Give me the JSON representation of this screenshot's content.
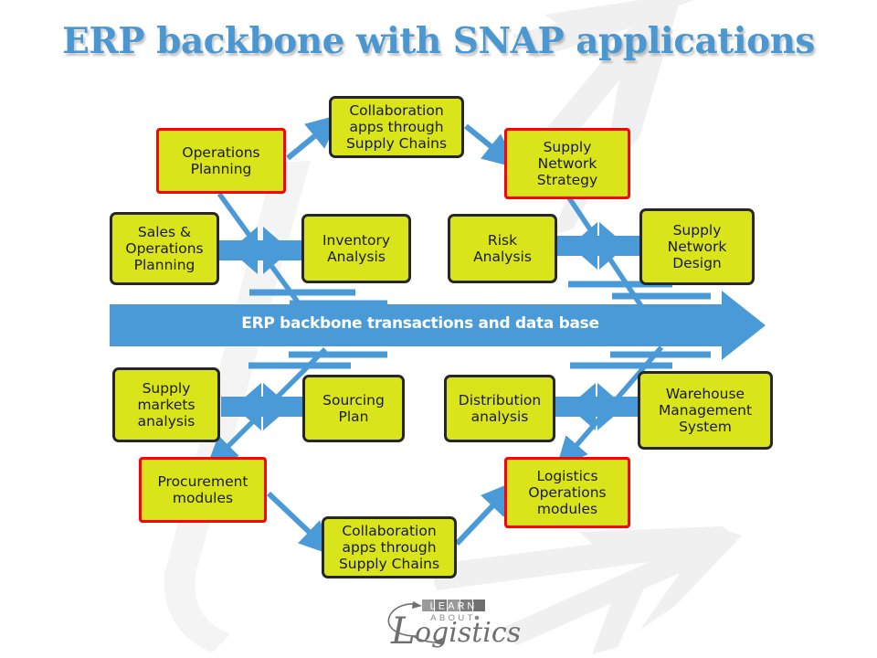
{
  "slide": {
    "title": "ERP backbone with SNAP applications",
    "background_color": "#ffffff"
  },
  "colors": {
    "accent_blue": "#4a9ad8",
    "title_blue": "#4a97d2",
    "node_fill": "#d9e51a",
    "node_border": "#262626",
    "highlight_border": "#ff0000",
    "watermark_grey": "#f0f0f0",
    "backbone_text": "#ffffff"
  },
  "backbone": {
    "label": "ERP backbone transactions and data base",
    "direction": "right"
  },
  "nodes": [
    {
      "id": "operations-planning",
      "label": "Operations\nPlanning",
      "highlight": true
    },
    {
      "id": "collaboration-apps-top",
      "label": "Collaboration\napps through\nSupply Chains",
      "highlight": false
    },
    {
      "id": "supply-network-strategy",
      "label": "Supply\nNetwork\nStrategy",
      "highlight": true
    },
    {
      "id": "sales-operations-planning",
      "label": "Sales &\nOperations\nPlanning",
      "highlight": false
    },
    {
      "id": "inventory-analysis",
      "label": "Inventory\nAnalysis",
      "highlight": false
    },
    {
      "id": "risk-analysis",
      "label": "Risk\nAnalysis",
      "highlight": false
    },
    {
      "id": "supply-network-design",
      "label": "Supply\nNetwork\nDesign",
      "highlight": false
    },
    {
      "id": "supply-markets-analysis",
      "label": "Supply\nmarkets\nanalysis",
      "highlight": false
    },
    {
      "id": "sourcing-plan",
      "label": "Sourcing\nPlan",
      "highlight": false
    },
    {
      "id": "distribution-analysis",
      "label": "Distribution\nanalysis",
      "highlight": false
    },
    {
      "id": "warehouse-management-system",
      "label": "Warehouse\nManagement\nSystem",
      "highlight": false
    },
    {
      "id": "procurement-modules",
      "label": "Procurement\nmodules",
      "highlight": true
    },
    {
      "id": "collaboration-apps-bottom",
      "label": "Collaboration\napps through\nSupply Chains",
      "highlight": false
    },
    {
      "id": "logistics-operations-modules",
      "label": "Logistics\nOperations\nmodules",
      "highlight": true
    }
  ],
  "logo": {
    "word_top": "LEARN",
    "word_mid": "ABOUT",
    "word_main_initial": "L",
    "word_main_rest": "ogistics",
    "full_text": "LEARN ABOUT Logistics"
  }
}
